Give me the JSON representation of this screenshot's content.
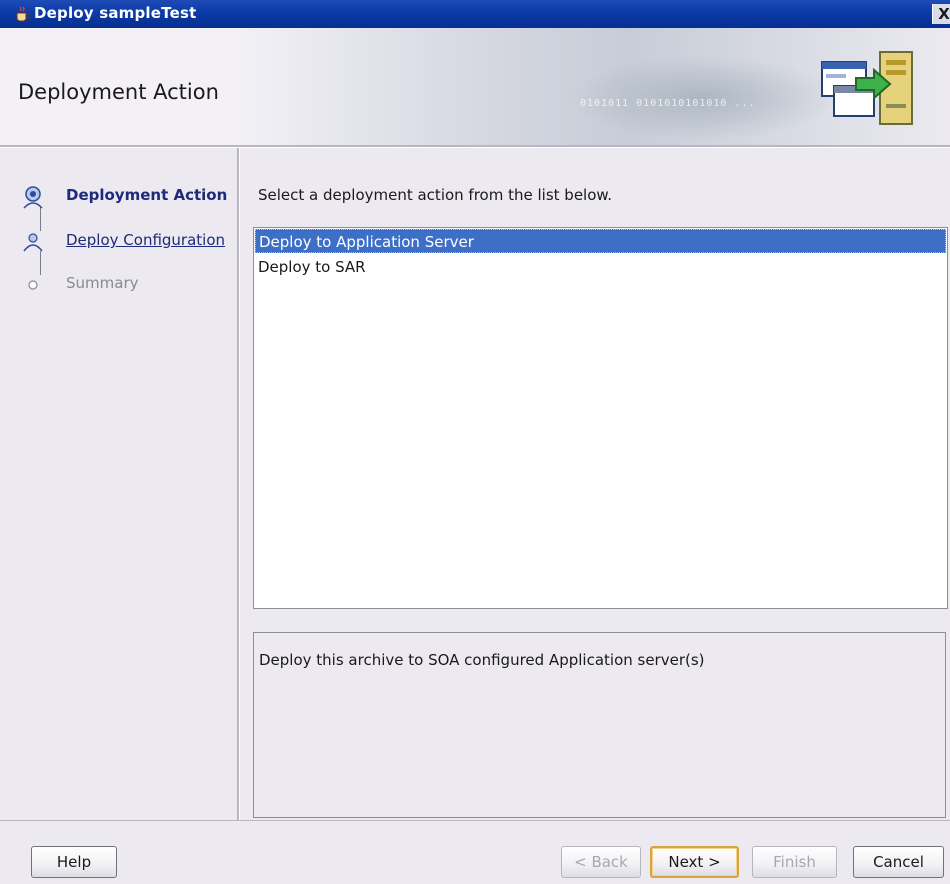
{
  "window": {
    "title": "Deploy sampleTest",
    "close_label": "X"
  },
  "header": {
    "title": "Deployment Action",
    "banner_binary": "0101011 0101010101010 ..."
  },
  "steps": [
    {
      "label": "Deployment Action",
      "state": "current"
    },
    {
      "label": "Deploy Configuration",
      "state": "link"
    },
    {
      "label": "Summary",
      "state": "disabled"
    }
  ],
  "main": {
    "instruction": "Select a deployment action from the list below.",
    "actions": [
      {
        "label": "Deploy to Application Server",
        "selected": true
      },
      {
        "label": "Deploy to SAR",
        "selected": false
      }
    ],
    "description": "Deploy this archive to SOA configured Application server(s)"
  },
  "buttons": {
    "help": "Help",
    "back": "< Back",
    "next": "Next >",
    "finish": "Finish",
    "cancel": "Cancel"
  },
  "colors": {
    "titlebar": "#0b3ba8",
    "selection": "#3d6fc7",
    "step_link": "#1c2b7a",
    "default_button_border": "#d9a53a"
  }
}
